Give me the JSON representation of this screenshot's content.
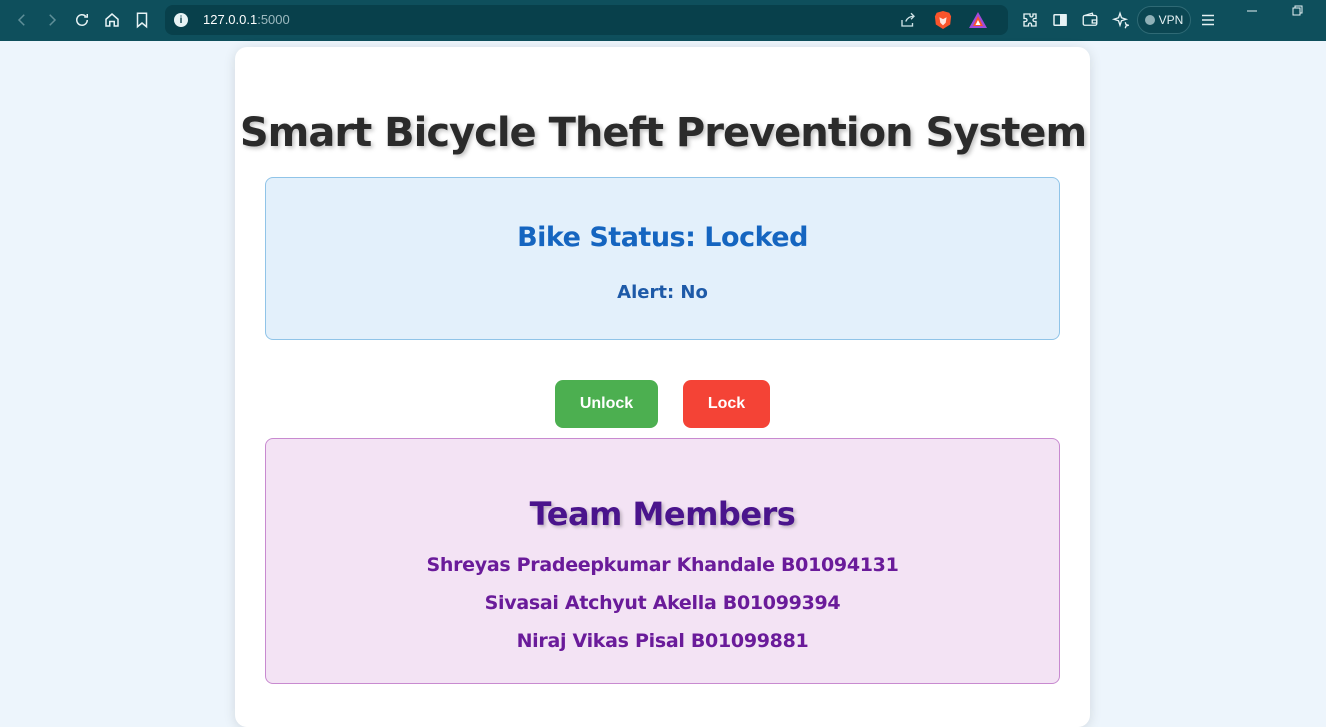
{
  "browser": {
    "url_host": "127.0.0.1",
    "url_port": ":5000",
    "vpn_label": "VPN",
    "icons": [
      "back-icon",
      "forward-icon",
      "reload-icon",
      "home-icon",
      "bookmark-icon",
      "site-info-icon",
      "share-icon",
      "brave-shields-icon",
      "brave-rewards-icon",
      "extensions-icon",
      "sidebar-icon",
      "wallet-icon",
      "leo-ai-icon",
      "menu-icon",
      "minimize-icon",
      "restore-icon"
    ]
  },
  "page": {
    "title": "Smart Bicycle Theft Prevention System",
    "status": {
      "title": "Bike Status: Locked",
      "alert": "Alert: No"
    },
    "buttons": {
      "unlock": "Unlock",
      "lock": "Lock"
    },
    "team": {
      "title": "Team Members",
      "members": [
        "Shreyas Pradeepkumar Khandale B01094131",
        "Sivasai Atchyut Akella B01099394",
        "Niraj Vikas Pisal B01099881"
      ]
    }
  },
  "colors": {
    "chrome": "#0e4f5c",
    "page_bg": "#edf5fc",
    "status_text": "#1565c0",
    "unlock_button": "#4caf50",
    "lock_button": "#f44336",
    "team_text": "#4a148c"
  }
}
